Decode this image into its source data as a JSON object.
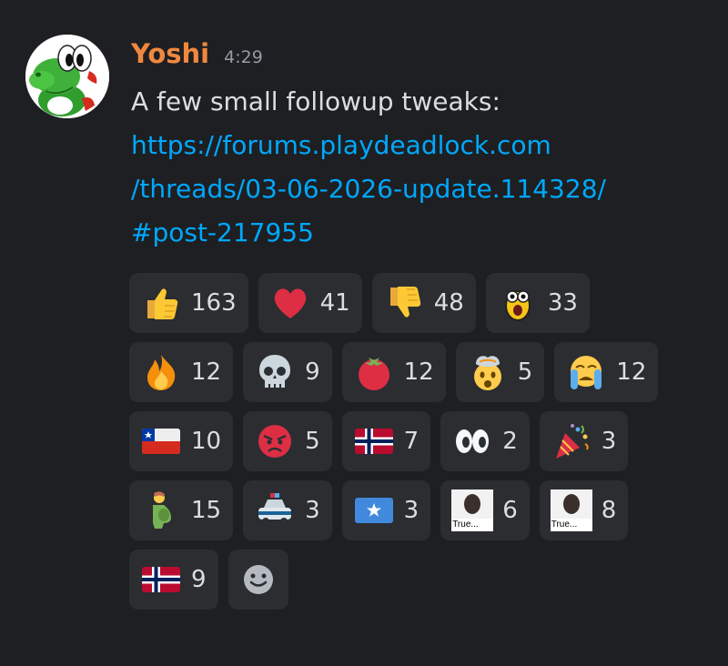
{
  "message": {
    "author": "Yoshi",
    "timestamp": "4:29",
    "text": "A few small followup tweaks:",
    "link_lines": [
      "https://forums.playdeadlock.com",
      "/threads/03-06-2026-update.114328/",
      "#post-217955"
    ]
  },
  "reactions": [
    {
      "emoji": "thumbs-up-icon",
      "count": "163"
    },
    {
      "emoji": "red-heart-icon",
      "count": "41"
    },
    {
      "emoji": "thumbs-down-icon",
      "count": "48"
    },
    {
      "emoji": "shocked-face-custom-icon",
      "count": "33"
    },
    {
      "emoji": "fire-icon",
      "count": "12"
    },
    {
      "emoji": "skull-icon",
      "count": "9"
    },
    {
      "emoji": "tomato-icon",
      "count": "12"
    },
    {
      "emoji": "exploding-head-icon",
      "count": "5"
    },
    {
      "emoji": "loudly-crying-face-icon",
      "count": "12"
    },
    {
      "emoji": "chile-flag-icon",
      "count": "10"
    },
    {
      "emoji": "angry-face-icon",
      "count": "5"
    },
    {
      "emoji": "norway-flag-icon",
      "count": "7"
    },
    {
      "emoji": "eyes-icon",
      "count": "2"
    },
    {
      "emoji": "party-popper-icon",
      "count": "3"
    },
    {
      "emoji": "pregnant-man-icon",
      "count": "15"
    },
    {
      "emoji": "police-car-icon",
      "count": "3"
    },
    {
      "emoji": "somalia-flag-icon",
      "count": "3"
    },
    {
      "emoji": "true-meme-custom-icon",
      "count": "6",
      "caption": "True..."
    },
    {
      "emoji": "true-meme-custom-icon",
      "count": "8",
      "caption": "True..."
    },
    {
      "emoji": "norway-flag-icon",
      "count": "9"
    }
  ],
  "add_reaction": {
    "icon": "add-reaction-smiley-icon"
  },
  "colors": {
    "background": "#1e1f22",
    "reaction_bg": "#2b2d31",
    "username": "#f0883e",
    "link": "#00a8fc",
    "text": "#dbdee1",
    "muted": "#949ba4"
  }
}
